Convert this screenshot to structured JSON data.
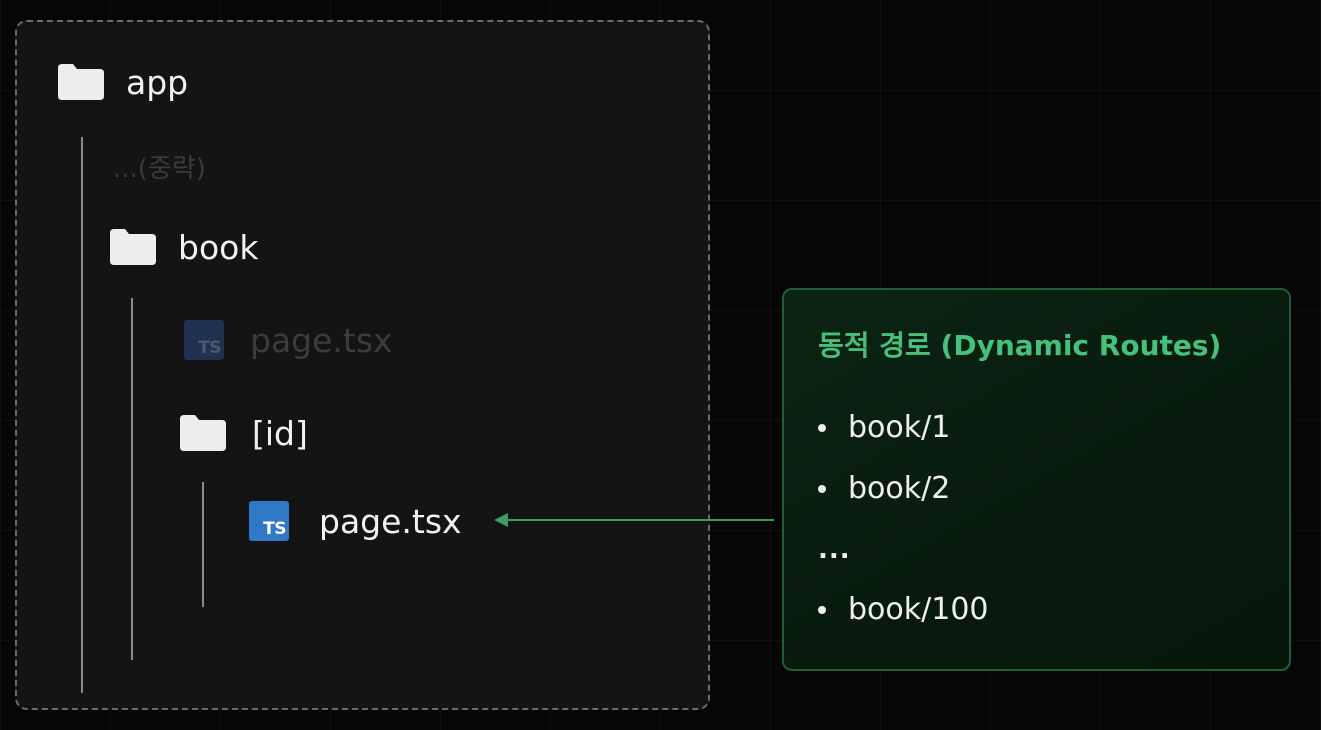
{
  "tree": {
    "root": {
      "label": "app",
      "icon": "folder-icon"
    },
    "omitted_text": "...(중략)",
    "book": {
      "label": "book",
      "icon": "folder-icon"
    },
    "book_page": {
      "label": "page.tsx",
      "icon": "ts-file-icon",
      "icon_text": "TS"
    },
    "id_folder": {
      "label": "[id]",
      "icon": "folder-icon"
    },
    "id_page": {
      "label": "page.tsx",
      "icon": "ts-file-icon",
      "icon_text": "TS"
    }
  },
  "routes": {
    "title": "동적 경로 (Dynamic Routes)",
    "items": [
      "book/1",
      "book/2"
    ],
    "ellipsis": "...",
    "last_item": "book/100"
  },
  "colors": {
    "accent_green": "#46c07a",
    "ts_blue": "#3178c6",
    "folder_white": "#eeeeee"
  }
}
